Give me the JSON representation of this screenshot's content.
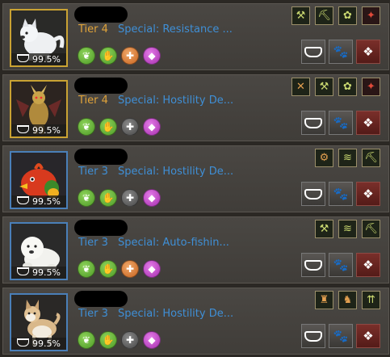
{
  "pets": [
    {
      "id": "pet-1",
      "species": "white-wolf",
      "border": "gold",
      "tier": "Tier 4",
      "special": "Special: Resistance ...",
      "food": "99.5%",
      "skills": [
        "green",
        "green",
        "orange",
        "purple"
      ],
      "passives": [
        {
          "icon": "ore-icon",
          "glyph": "⚒",
          "tone": "normal"
        },
        {
          "icon": "pickaxe-icon",
          "glyph": "⛏",
          "tone": "normal"
        },
        {
          "icon": "gathering-icon",
          "glyph": "✿",
          "tone": "normal"
        },
        {
          "icon": "boss-icon",
          "glyph": "✦",
          "tone": "red"
        }
      ]
    },
    {
      "id": "pet-2",
      "species": "demon-knight",
      "border": "gold",
      "tier": "Tier 4",
      "special": "Special: Hostility De...",
      "food": "99.5%",
      "skills": [
        "green",
        "green",
        "gray",
        "purple"
      ],
      "passives": [
        {
          "icon": "axe-icon",
          "glyph": "✕",
          "tone": "orange"
        },
        {
          "icon": "ore-icon",
          "glyph": "⚒",
          "tone": "normal"
        },
        {
          "icon": "gathering-icon",
          "glyph": "✿",
          "tone": "normal"
        },
        {
          "icon": "boss-icon",
          "glyph": "✦",
          "tone": "red"
        }
      ]
    },
    {
      "id": "pet-3",
      "species": "red-bird",
      "border": "blue",
      "tier": "Tier 3",
      "special": "Special: Hostility De...",
      "food": "99.5%",
      "skills": [
        "green",
        "green",
        "gray",
        "purple"
      ],
      "passives": [
        {
          "icon": "cart-icon",
          "glyph": "⚙",
          "tone": "orange"
        },
        {
          "icon": "wing-icon",
          "glyph": "≋",
          "tone": "normal"
        },
        {
          "icon": "pickaxe-icon",
          "glyph": "⛏",
          "tone": "normal"
        }
      ]
    },
    {
      "id": "pet-4",
      "species": "white-seal",
      "border": "blue",
      "tier": "Tier 3",
      "special": "Special: Auto-fishin...",
      "food": "99.5%",
      "skills": [
        "green",
        "green",
        "orange",
        "purple"
      ],
      "passives": [
        {
          "icon": "ore-icon",
          "glyph": "⚒",
          "tone": "normal"
        },
        {
          "icon": "wing-icon",
          "glyph": "≋",
          "tone": "normal"
        },
        {
          "icon": "pickaxe-icon",
          "glyph": "⛏",
          "tone": "normal"
        }
      ]
    },
    {
      "id": "pet-5",
      "species": "shiba-dog",
      "border": "blue",
      "tier": "Tier 3",
      "special": "Special: Hostility De...",
      "food": "99.5%",
      "skills": [
        "green",
        "green",
        "gray",
        "purple"
      ],
      "passives": [
        {
          "icon": "potion-icon",
          "glyph": "♜",
          "tone": "orange"
        },
        {
          "icon": "beast-icon",
          "glyph": "♞",
          "tone": "orange"
        },
        {
          "icon": "upgrade-icon",
          "glyph": "⇈",
          "tone": "normal"
        }
      ]
    }
  ]
}
